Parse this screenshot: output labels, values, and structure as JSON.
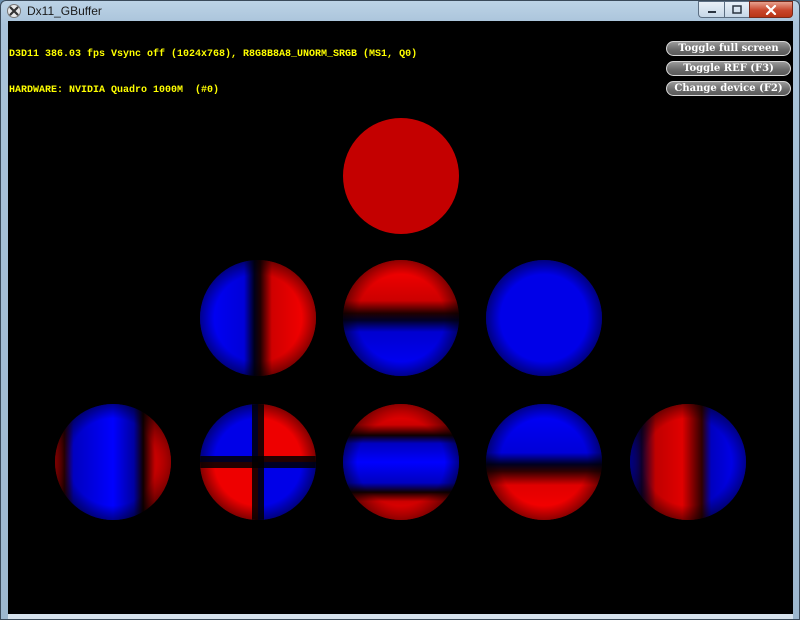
{
  "window": {
    "title": "Dx11_GBuffer",
    "icon": "directx-x-icon",
    "caption_buttons": [
      "minimize-icon",
      "maximize-icon",
      "close-icon"
    ]
  },
  "stats": {
    "line1": "D3D11 386.03 fps Vsync off (1024x768), R8G8B8A8_UNORM_SRGB (MS1, Q0)",
    "line2": "HARDWARE: NVIDIA Quadro 1000M  (#0)"
  },
  "hud": {
    "toggle_full_screen": "Toggle full screen",
    "toggle_ref": "Toggle REF (F3)",
    "change_device": "Change device (F2)"
  },
  "colors": {
    "background": "#000000",
    "stats_text": "#ffff00",
    "positive": "#ff0000",
    "negative": "#0000ff"
  }
}
